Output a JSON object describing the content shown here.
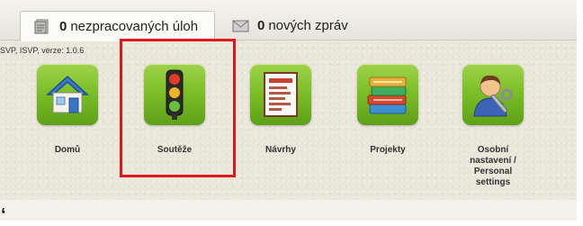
{
  "tabs": [
    {
      "count": "0",
      "label": "nezpracovaných úloh",
      "icon": "document-icon",
      "active": true
    },
    {
      "count": "0",
      "label": "nových zpráv",
      "icon": "mail-icon",
      "active": false
    }
  ],
  "version_text": "SVP, ISVP, verze: 1.0.6",
  "tiles": [
    {
      "label": "Domů",
      "icon": "home-icon"
    },
    {
      "label": "Soutěže",
      "icon": "traffic-light-icon"
    },
    {
      "label": "Návrhy",
      "icon": "proposal-document-icon"
    },
    {
      "label": "Projekty",
      "icon": "books-icon"
    },
    {
      "label_lines": [
        "Osobní",
        "nastavení /",
        "Personal",
        "settings"
      ],
      "icon": "user-settings-icon"
    }
  ],
  "colors": {
    "tile_green": "#7cbf28",
    "highlight_red": "#e0161b",
    "panel_bg": "#e9e6da"
  }
}
